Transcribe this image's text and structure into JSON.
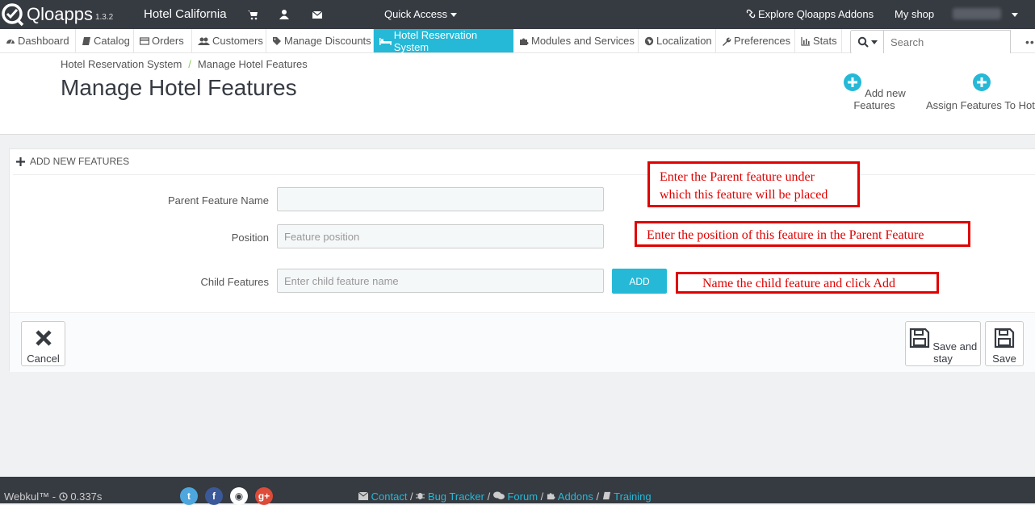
{
  "brand": {
    "name": "Qloapps",
    "version": "1.3.2"
  },
  "topbar": {
    "shop_name": "Hotel California",
    "quick_access": "Quick Access",
    "explore": "Explore Qloapps Addons",
    "my_shop": "My shop"
  },
  "menu": {
    "items": [
      {
        "label": "Dashboard",
        "icon": "dashboard-icon"
      },
      {
        "label": "Catalog",
        "icon": "book-icon"
      },
      {
        "label": "Orders",
        "icon": "credit-card-icon"
      },
      {
        "label": "Customers",
        "icon": "users-icon"
      },
      {
        "label": "Manage Discounts",
        "icon": "tags-icon"
      },
      {
        "label": "Hotel Reservation System",
        "icon": "bed-icon",
        "active": true
      },
      {
        "label": "Modules and Services",
        "icon": "puzzle-icon"
      },
      {
        "label": "Localization",
        "icon": "globe-icon"
      },
      {
        "label": "Preferences",
        "icon": "wrench-icon"
      },
      {
        "label": "Stats",
        "icon": "bar-chart-icon"
      }
    ],
    "search_placeholder": "Search"
  },
  "header": {
    "breadcrumb": [
      "Hotel Reservation System",
      "Manage Hotel Features"
    ],
    "title": "Manage Hotel Features",
    "tools": [
      "Add new Features",
      "Assign Features To Hotel"
    ]
  },
  "panel": {
    "heading": "ADD NEW FEATURES",
    "fields": {
      "parent_label": "Parent Feature Name",
      "parent_value": "",
      "position_label": "Position",
      "position_placeholder": "Feature position",
      "child_label": "Child Features",
      "child_placeholder": "Enter child feature name"
    },
    "add_button": "ADD",
    "cancel": "Cancel",
    "save_and_stay": "Save and stay",
    "save": "Save"
  },
  "annotations": {
    "parent": [
      "Enter the Parent feature under",
      "which this feature will be placed"
    ],
    "position": "Enter the position of this feature in the Parent Feature",
    "child": "Name the child feature and click Add"
  },
  "footer": {
    "company": "Webkul™",
    "time": "0.337s",
    "links": [
      "Contact",
      "Bug Tracker",
      "Forum",
      "Addons",
      "Training"
    ]
  },
  "colors": {
    "accent": "#25b9d7",
    "topbar": "#363a41",
    "annotation": "#e00000"
  }
}
